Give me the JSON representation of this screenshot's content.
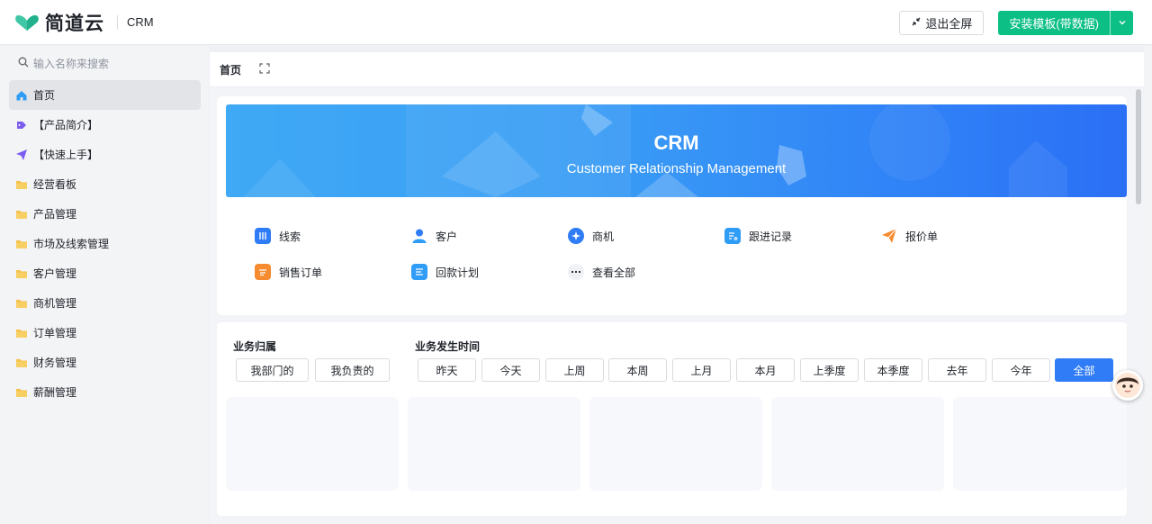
{
  "header": {
    "logo_text": "简道云",
    "app_name": "CRM",
    "exit_fullscreen_label": "退出全屏",
    "install_label": "安装模板(带数据)"
  },
  "sidebar": {
    "search_placeholder": "输入名称来搜索",
    "items": [
      {
        "label": "首页",
        "icon": "home-icon"
      },
      {
        "label": "【产品简介】",
        "icon": "tag-icon"
      },
      {
        "label": "【快速上手】",
        "icon": "send-icon"
      },
      {
        "label": "经营看板",
        "icon": "folder-icon"
      },
      {
        "label": "产品管理",
        "icon": "folder-icon"
      },
      {
        "label": "市场及线索管理",
        "icon": "folder-icon"
      },
      {
        "label": "客户管理",
        "icon": "folder-icon"
      },
      {
        "label": "商机管理",
        "icon": "folder-icon"
      },
      {
        "label": "订单管理",
        "icon": "folder-icon"
      },
      {
        "label": "财务管理",
        "icon": "folder-icon"
      },
      {
        "label": "薪酬管理",
        "icon": "folder-icon"
      }
    ]
  },
  "tabs": {
    "home_label": "首页"
  },
  "banner": {
    "title": "CRM",
    "subtitle": "Customer Relationship Management"
  },
  "shortcuts": [
    {
      "label": "线索",
      "icon": "clue-icon",
      "color": "#2f7cf6"
    },
    {
      "label": "客户",
      "icon": "customer-icon",
      "color": "#2f7cf6"
    },
    {
      "label": "商机",
      "icon": "opportunity-icon",
      "color": "#2f7cf6"
    },
    {
      "label": "跟进记录",
      "icon": "followup-icon",
      "color": "#2f9cf6"
    },
    {
      "label": "报价单",
      "icon": "quote-icon",
      "color": "#f68b2f"
    },
    {
      "label": "销售订单",
      "icon": "order-icon",
      "color": "#f68b2f"
    },
    {
      "label": "回款计划",
      "icon": "payment-icon",
      "color": "#2f9cf6"
    },
    {
      "label": "查看全部",
      "icon": "more-icon",
      "color": "#e8eaee"
    }
  ],
  "filters": {
    "ownership_label": "业务归属",
    "ownership_options": [
      "我部门的",
      "我负责的"
    ],
    "time_label": "业务发生时间",
    "time_options": [
      "昨天",
      "今天",
      "上周",
      "本周",
      "上月",
      "本月",
      "上季度",
      "本季度",
      "去年",
      "今年",
      "全部"
    ],
    "time_selected": "全部"
  },
  "colors": {
    "accent": "#0bbf85",
    "primary": "#2f7cf6"
  }
}
